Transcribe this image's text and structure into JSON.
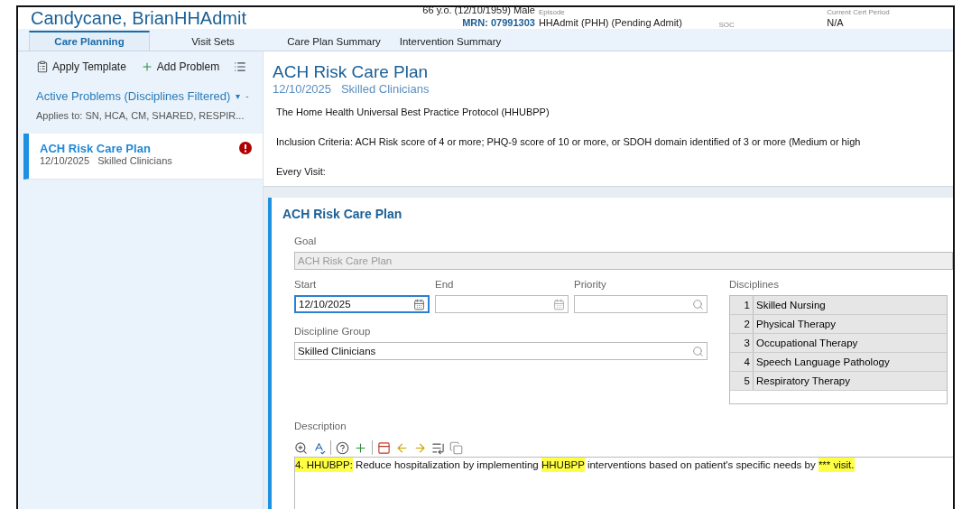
{
  "header": {
    "patient_name": "Candycane, BrianHHAdmit",
    "demographics": "66 y.o. (12/10/1959) Male",
    "mrn": "MRN: 07991303",
    "episode_label": "Episode",
    "episode": "HHAdmit (PHH) (Pending Admit)",
    "soc_label": "SOC",
    "cert_label": "Current Cert Period",
    "cert": "N/A"
  },
  "tabs": [
    {
      "label": "Care Planning",
      "selected": true
    },
    {
      "label": "Visit Sets",
      "selected": false
    },
    {
      "label": "Care Plan Summary",
      "selected": false
    },
    {
      "label": "Intervention Summary",
      "selected": false
    }
  ],
  "sidebar": {
    "toolbar": [
      "Apply Template",
      "Add Problem"
    ],
    "filter": "Active Problems (Disciplines Filtered)",
    "filter_caret": "▾",
    "collapse": "-",
    "applies_to": "Applies to: SN, HCA, CM, SHARED, RESPIR...",
    "problems": [
      {
        "title": "ACH Risk Care Plan",
        "date": "12/10/2025",
        "group": "Skilled Clinicians",
        "selected": true,
        "alert": true
      }
    ]
  },
  "plan": {
    "title": "ACH Risk Care Plan",
    "date": "12/10/2025",
    "group": "Skilled Clinicians",
    "lines": [
      "The Home Health Universal Best Practice Protocol (HHUBPP)",
      "Inclusion Criteria: ACH Risk score of 4 or more; PHQ-9 score of 10 or more, or SDOH domain identified of 3 or more (Medium or high",
      "Every Visit:"
    ]
  },
  "goal_card": {
    "title": "ACH Risk Care Plan",
    "goal_label": "Goal",
    "goal": "ACH Risk Care Plan",
    "start_label": "Start",
    "start": "12/10/2025",
    "end_label": "End",
    "priority_label": "Priority",
    "group_label": "Discipline Group",
    "group": "Skilled Clinicians",
    "disciplines_label": "Disciplines",
    "disciplines": [
      {
        "num": "1",
        "name": "Skilled Nursing"
      },
      {
        "num": "2",
        "name": "Physical Therapy"
      },
      {
        "num": "3",
        "name": "Occupational Therapy"
      },
      {
        "num": "4",
        "name": "Speech Language Pathology"
      },
      {
        "num": "5",
        "name": "Respiratory Therapy"
      }
    ],
    "description_label": "Description",
    "description": [
      {
        "text": "4. HHUBPP:",
        "highlighted": true
      },
      {
        "text": " Reduce hospitalization by implementing ",
        "highlighted": false
      },
      {
        "text": "HHUBPP",
        "highlighted": true
      },
      {
        "text": " interventions based on patient's specific needs by ",
        "highlighted": false
      },
      {
        "text": "*** visit.",
        "highlighted": true
      }
    ]
  }
}
